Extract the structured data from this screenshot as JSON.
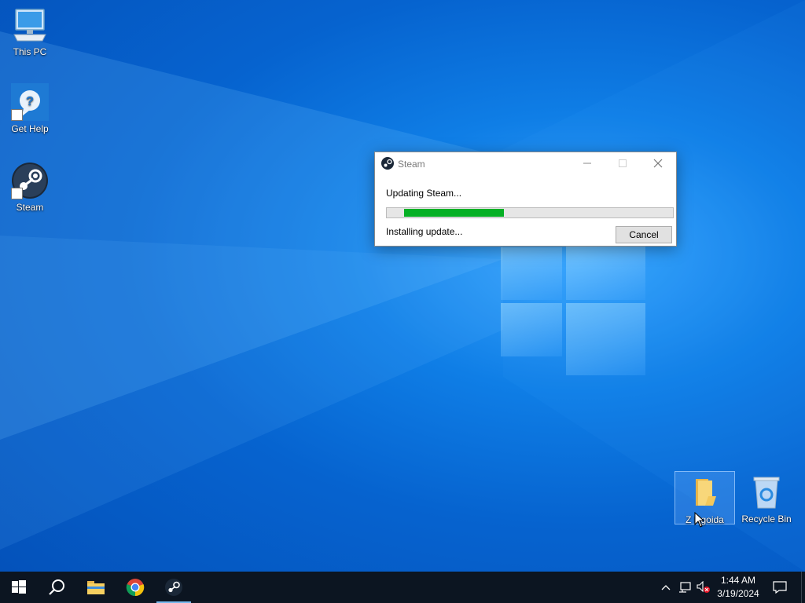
{
  "desktop": {
    "icons_left": [
      {
        "label": "This PC",
        "icon": "this-pc-icon"
      },
      {
        "label": "Get Help",
        "icon": "get-help-icon"
      },
      {
        "label": "Steam",
        "icon": "steam-icon"
      }
    ],
    "icons_right": [
      {
        "label": "Z Ngoida",
        "icon": "folder-icon",
        "selected": true
      },
      {
        "label": "Recycle Bin",
        "icon": "recycle-bin-icon"
      }
    ]
  },
  "dialog": {
    "title": "Steam",
    "status_top": "Updating Steam...",
    "status_bottom": "Installing update...",
    "cancel_label": "Cancel",
    "progress_fraction": 0.35,
    "progress_color": "#06b025"
  },
  "taskbar": {
    "buttons": [
      "start-icon",
      "search-icon",
      "file-explorer-icon",
      "chrome-icon",
      "steam-icon"
    ],
    "active_button": "steam-icon",
    "tray_icons": [
      "chevron-up-icon",
      "network-icon",
      "volume-muted-icon"
    ],
    "clock": {
      "time": "1:44 AM",
      "date": "3/19/2024"
    },
    "notification_icon": "action-center-icon"
  },
  "colors": {
    "taskbar": "#0c1521",
    "accent": "#76b9ed"
  }
}
